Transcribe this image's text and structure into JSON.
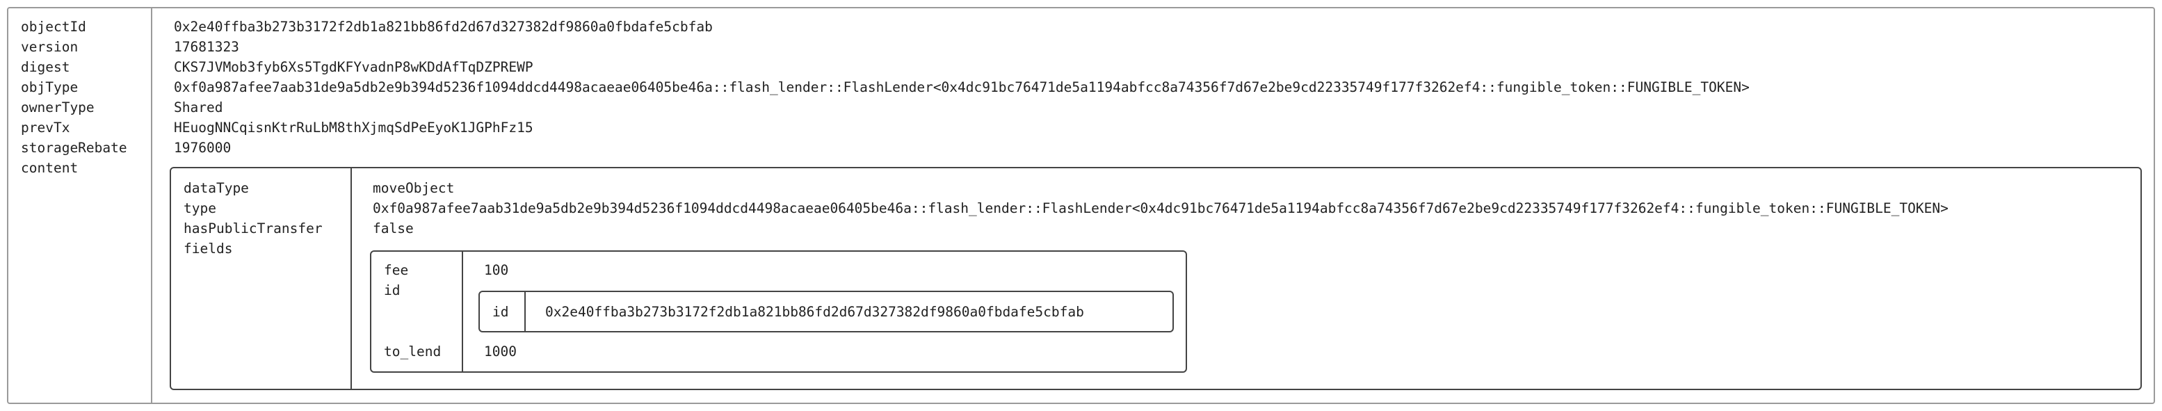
{
  "object": {
    "labels": [
      "objectId",
      "version",
      "digest",
      "objType",
      "ownerType",
      "prevTx",
      "storageRebate",
      "content"
    ],
    "values": [
      "0x2e40ffba3b273b3172f2db1a821bb86fd2d67d327382df9860a0fbdafe5cbfab",
      "17681323",
      "CKS7JVMob3fyb6Xs5TgdKFYvadnP8wKDdAfTqDZPREWP",
      "0xf0a987afee7aab31de9a5db2e9b394d5236f1094ddcd4498acaeae06405be46a::flash_lender::FlashLender<0x4dc91bc76471de5a1194abfcc8a74356f7d67e2be9cd22335749f177f3262ef4::fungible_token::FUNGIBLE_TOKEN>",
      "Shared",
      "HEuogNNCqisnKtrRuLbM8thXjmqSdPeEyoK1JGPhFz15",
      "1976000"
    ]
  },
  "content": {
    "labels": [
      "dataType",
      "type",
      "hasPublicTransfer",
      "fields"
    ],
    "values": [
      "moveObject",
      "0xf0a987afee7aab31de9a5db2e9b394d5236f1094ddcd4498acaeae06405be46a::flash_lender::FlashLender<0x4dc91bc76471de5a1194abfcc8a74356f7d67e2be9cd22335749f177f3262ef4::fungible_token::FUNGIBLE_TOKEN>",
      "false"
    ]
  },
  "fields": {
    "labels": [
      "fee",
      "id",
      "to_lend"
    ],
    "fee": "100",
    "id": {
      "label": "id",
      "value": "0x2e40ffba3b273b3172f2db1a821bb86fd2d67d327382df9860a0fbdafe5cbfab"
    },
    "to_lend": "1000"
  }
}
